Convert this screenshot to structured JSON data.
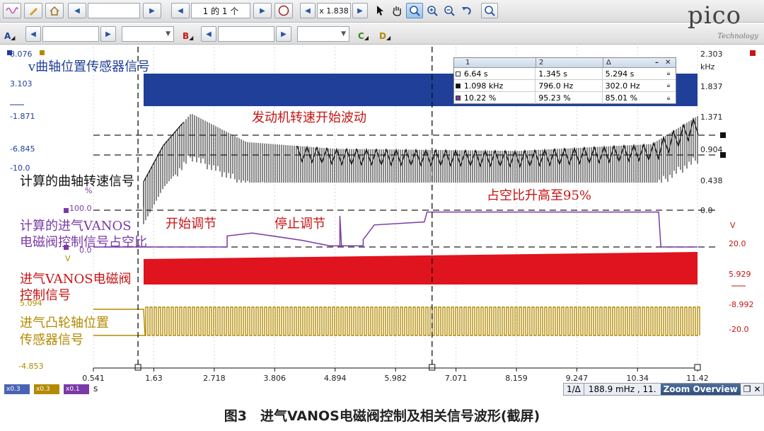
{
  "toolbar1": {
    "icon_left_1": "signal-icon",
    "icon_left_2": "pencil-icon",
    "icon_left_3": "home-icon",
    "pager_text": "1 的 1 个",
    "zoom_text": "x 1.838",
    "tools": [
      "pointer-icon",
      "hand-icon",
      "zoom-in-active-icon",
      "zoom-in-icon",
      "zoom-out-icon",
      "undo-icon",
      "zoom-fit-icon"
    ]
  },
  "toolbar2": {
    "channels": [
      {
        "letter": "A",
        "color": "#1f3f99"
      },
      {
        "letter": "B",
        "color": "#c81414"
      },
      {
        "letter": "C",
        "color": "#3a8a1a"
      },
      {
        "letter": "D",
        "color": "#b38a00"
      }
    ]
  },
  "logo": {
    "text": "pico",
    "sub": "Technology"
  },
  "measurements": {
    "headers": [
      "1",
      "2",
      "Δ"
    ],
    "rows": [
      {
        "marker_color": "#ffffff",
        "v1": "6.64 s",
        "v2": "1.345 s",
        "delta": "5.294 s"
      },
      {
        "marker_color": "#111111",
        "v1": "1.098 kHz",
        "v2": "796.0 Hz",
        "delta": "302.0 Hz"
      },
      {
        "marker_color": "#7a3aa6",
        "v1": "10.22 %",
        "v2": "95.23 %",
        "delta": "85.01 %"
      }
    ]
  },
  "axes": {
    "left_blue": {
      "values": [
        "8.076",
        "3.103",
        "-1.871",
        "-6.845",
        "-10.0"
      ],
      "color": "#1f3f99"
    },
    "left_purple": {
      "unit": "%",
      "values": [
        "100.0",
        "0.0"
      ],
      "unit2": "V",
      "color": "#7a3aa6"
    },
    "left_gold": {
      "values": [
        "5.094",
        "-4.853"
      ],
      "color": "#b38a00"
    },
    "right_black": {
      "unit": "kHz",
      "values": [
        "2.303",
        "1.837",
        "1.371",
        "0.904",
        "0.438",
        "0.0"
      ],
      "color": "#222222"
    },
    "right_red": {
      "unit": "V",
      "values": [
        "20.0",
        "5.929",
        "-8.992",
        "-20.0"
      ],
      "color": "#c81414"
    },
    "x_unit": "s",
    "x_ticks": [
      "0.541",
      "1.63",
      "2.718",
      "3.806",
      "4.894",
      "5.982",
      "7.071",
      "8.159",
      "9.247",
      "10.34",
      "11.42"
    ]
  },
  "labels": {
    "blue": "v曲轴位置传感器信号",
    "black_anno": "发动机转速开始波动",
    "black": "计算的曲轴转速信号",
    "purple_anno_1": "开始调节",
    "purple_anno_2": "停止调节",
    "purple_anno_3": "占空比升高至95%",
    "purple_line1": "计算的进气VANOS",
    "purple_line2": "电磁阀控制信号占空比",
    "red_line1": "进气VANOS电磁阀",
    "red_line2": "控制信号",
    "gold_line1": "进气凸轮轴位置",
    "gold_line2": "传感器信号"
  },
  "status": {
    "swatches": [
      {
        "text": "x0.3",
        "color": "#4a64b4"
      },
      {
        "text": "x0.3",
        "color": "#b38a00"
      },
      {
        "text": "x0.1",
        "color": "#7a3aa6"
      }
    ],
    "unit": "s",
    "zoom_readout": "188.9 mHz , 11.",
    "zoom_title": "Zoom Overview",
    "ruler_label": "1/Δ"
  },
  "caption": "图3　进气VANOS电磁阀控制及相关信号波形(截屏)",
  "colors": {
    "blue": "#1f3f99",
    "black": "#111111",
    "purple": "#7a3aa6",
    "red": "#e0141e",
    "gold": "#b38a00"
  },
  "traces": {
    "black_rpm_khz": [
      {
        "t": 0.541,
        "f": 0.08
      },
      {
        "t": 1.3,
        "f": 0.2
      },
      {
        "t": 1.8,
        "f": 0.95
      },
      {
        "t": 2.3,
        "f": 1.42
      },
      {
        "t": 3.3,
        "f": 1.0
      },
      {
        "t": 4.9,
        "f": 0.9
      },
      {
        "t": 8.2,
        "f": 0.87
      },
      {
        "t": 10.6,
        "f": 0.97
      },
      {
        "t": 11.42,
        "f": 1.38
      }
    ],
    "purple_duty_percent": [
      {
        "t": 0.541,
        "d": 0
      },
      {
        "t": 2.95,
        "d": 0
      },
      {
        "t": 2.95,
        "d": 30
      },
      {
        "t": 3.4,
        "d": 38
      },
      {
        "t": 4.3,
        "d": 18
      },
      {
        "t": 4.8,
        "d": 3
      },
      {
        "t": 5.4,
        "d": 3
      },
      {
        "t": 5.4,
        "d": 20
      },
      {
        "t": 5.6,
        "d": 60
      },
      {
        "t": 6.5,
        "d": 68
      },
      {
        "t": 6.55,
        "d": 95
      },
      {
        "t": 10.72,
        "d": 95
      },
      {
        "t": 10.76,
        "d": 0
      },
      {
        "t": 11.42,
        "d": 0
      }
    ],
    "ruler_times": [
      1.345,
      6.64
    ]
  }
}
